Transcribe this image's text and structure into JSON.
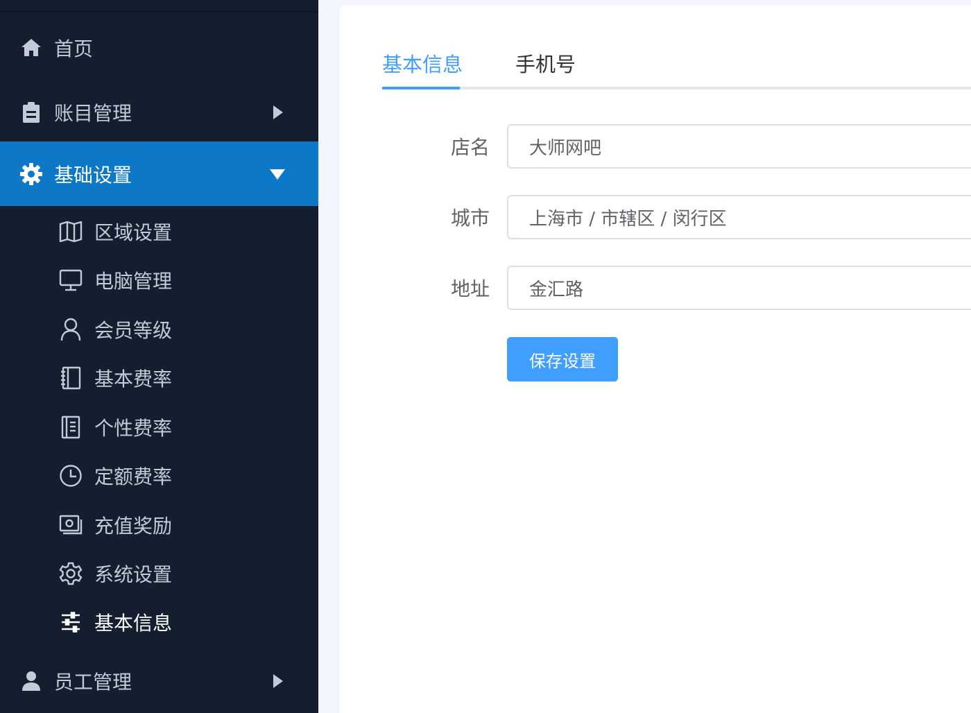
{
  "sidebar": {
    "items": [
      {
        "label": "首页",
        "icon": "home-icon"
      },
      {
        "label": "账目管理",
        "icon": "clipboard-icon",
        "has_arrow": true
      },
      {
        "label": "基础设置",
        "icon": "gear-icon",
        "expanded": true
      },
      {
        "label": "员工管理",
        "icon": "user-icon",
        "has_arrow": true
      }
    ],
    "sub_items": [
      {
        "label": "区域设置",
        "icon": "map-icon"
      },
      {
        "label": "电脑管理",
        "icon": "monitor-icon"
      },
      {
        "label": "会员等级",
        "icon": "user-outline-icon"
      },
      {
        "label": "基本费率",
        "icon": "notebook-icon"
      },
      {
        "label": "个性费率",
        "icon": "document-icon"
      },
      {
        "label": "定额费率",
        "icon": "clock-icon"
      },
      {
        "label": "充值奖励",
        "icon": "money-icon"
      },
      {
        "label": "系统设置",
        "icon": "settings-outline-icon"
      },
      {
        "label": "基本信息",
        "icon": "sliders-icon",
        "current": true
      }
    ]
  },
  "main": {
    "tabs": [
      {
        "label": "基本信息",
        "active": true
      },
      {
        "label": "手机号",
        "active": false
      }
    ],
    "form": {
      "shop_name": {
        "label": "店名",
        "value": "大师网吧"
      },
      "city": {
        "label": "城市",
        "value": "上海市 / 市辖区 / 闵行区"
      },
      "address": {
        "label": "地址",
        "value": "金汇路"
      }
    },
    "save_label": "保存设置"
  },
  "colors": {
    "sidebar_bg": "#141e2f",
    "active_bg": "#0c78c7",
    "primary": "#409eff"
  }
}
